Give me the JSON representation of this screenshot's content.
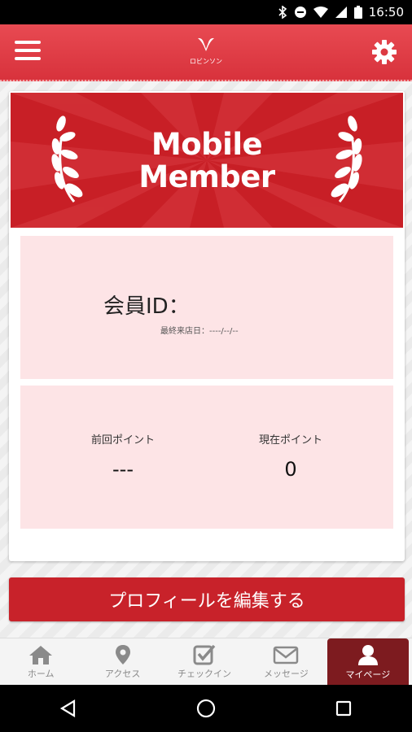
{
  "status_bar": {
    "time": "16:50"
  },
  "header": {
    "logo_text": "ロビンソン"
  },
  "banner": {
    "title_line1": "Mobile",
    "title_line2": "Member"
  },
  "member": {
    "id_label": "会員ID：",
    "id_value": "",
    "last_visit": "最終来店日：----/--/--"
  },
  "points": {
    "previous_label": "前回ポイント",
    "previous_value": "---",
    "current_label": "現在ポイント",
    "current_value": "0"
  },
  "profile_button": "プロフィールを編集する",
  "tabs": [
    {
      "label": "ホーム",
      "icon": "home-icon"
    },
    {
      "label": "アクセス",
      "icon": "map-pin-icon"
    },
    {
      "label": "チェックイン",
      "icon": "checkbox-icon"
    },
    {
      "label": "メッセージ",
      "icon": "mail-icon"
    },
    {
      "label": "マイページ",
      "icon": "person-icon",
      "active": true
    }
  ],
  "colors": {
    "brand_red": "#c8222a",
    "panel_pink": "#fde4e6",
    "active_tab": "#7d1b1f"
  }
}
